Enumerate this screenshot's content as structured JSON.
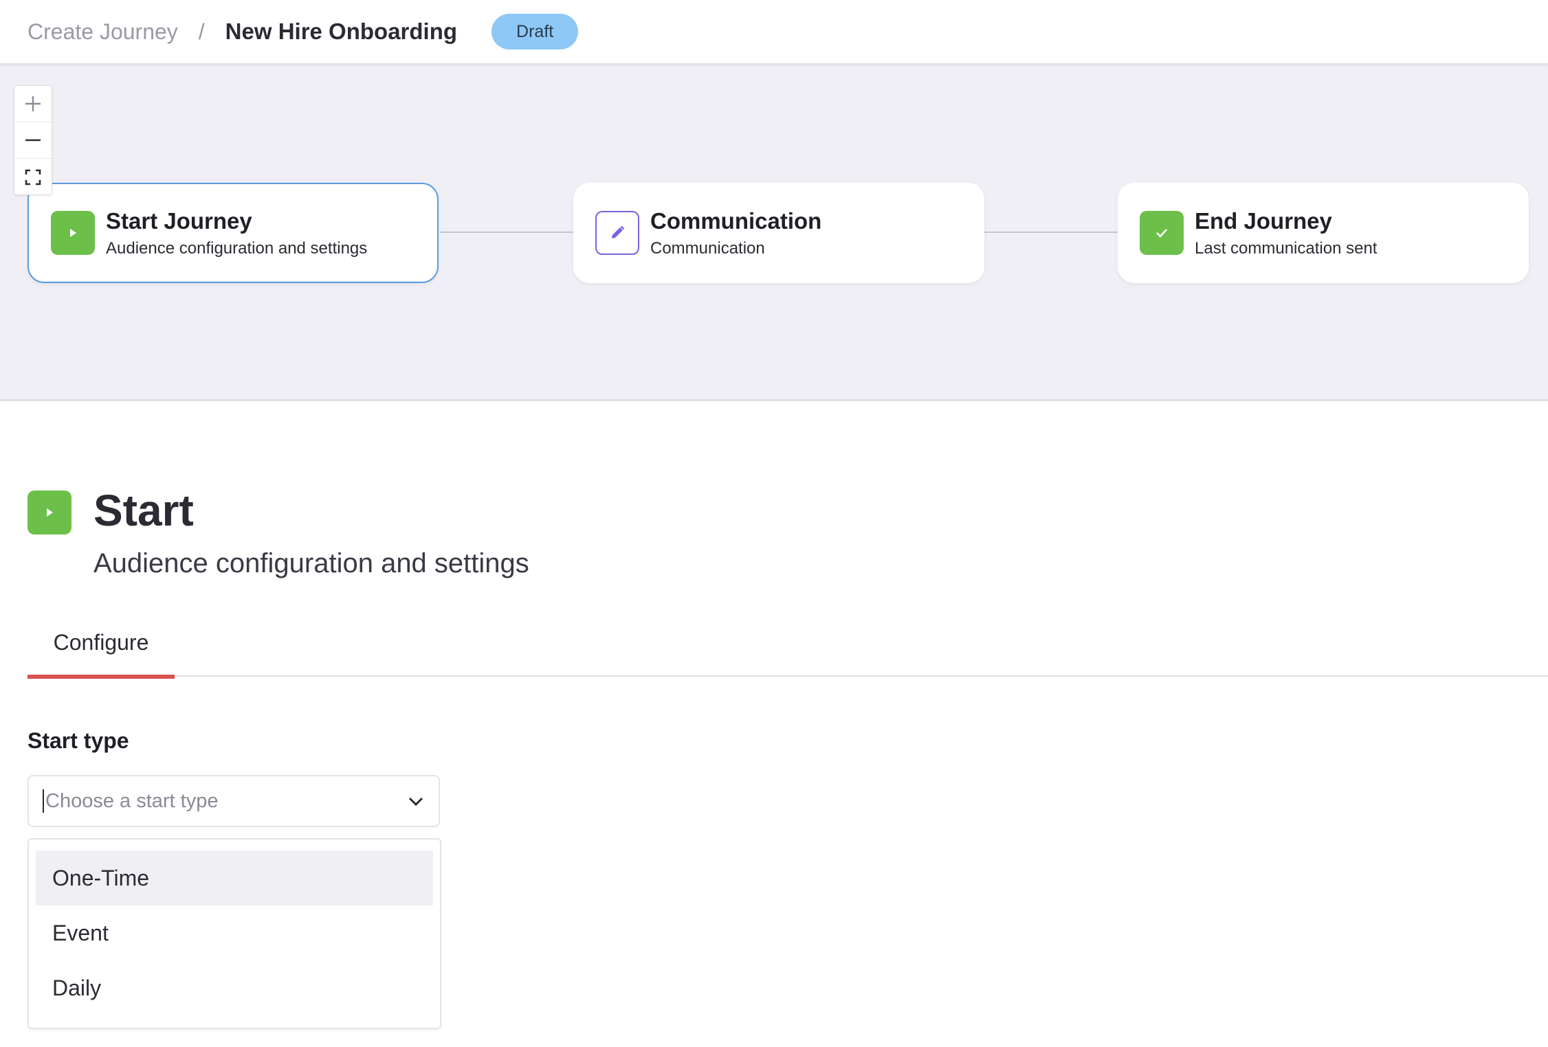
{
  "header": {
    "breadcrumb_parent": "Create Journey",
    "breadcrumb_separator": "/",
    "breadcrumb_current": "New Hire Onboarding",
    "status_badge": "Draft"
  },
  "zoom_controls": {
    "zoom_in_icon": "plus-icon",
    "zoom_out_icon": "minus-icon",
    "fit_icon": "fullscreen-icon"
  },
  "nodes": [
    {
      "title": "Start Journey",
      "subtitle": "Audience configuration and settings",
      "icon": "play-icon",
      "selected": true
    },
    {
      "title": "Communication",
      "subtitle": "Communication",
      "icon": "pencil-icon",
      "selected": false
    },
    {
      "title": "End Journey",
      "subtitle": "Last communication sent",
      "icon": "check-icon",
      "selected": false
    }
  ],
  "detail": {
    "title": "Start",
    "subtitle": "Audience configuration and settings",
    "tabs": [
      {
        "label": "Configure",
        "active": true
      }
    ],
    "start_type": {
      "label": "Start type",
      "placeholder": "Choose a start type",
      "value": "",
      "options": [
        "One-Time",
        "Event",
        "Daily"
      ],
      "highlighted_option": "One-Time"
    }
  },
  "colors": {
    "accent_green": "#6cc04a",
    "accent_purple": "#7b62e0",
    "selected_border": "#5b9be0",
    "tab_underline": "#d9534f",
    "badge_bg": "#8ec8f7",
    "canvas_bg": "#f0eff5"
  }
}
